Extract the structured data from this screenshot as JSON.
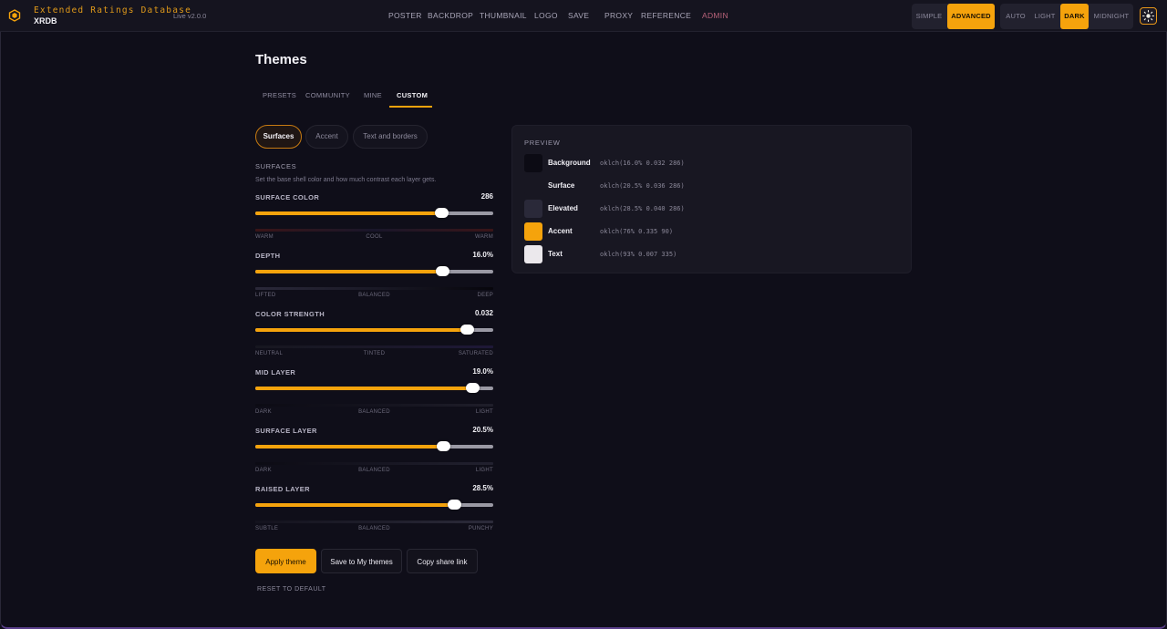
{
  "app": {
    "brand_title": "Extended Ratings Database",
    "brand_sub": "XRDB",
    "version": "Live v2.0.0",
    "logo_icon": "hexagon-cube-icon"
  },
  "nav": [
    "POSTER",
    "BACKDROP",
    "THUMBNAIL",
    "LOGO",
    "SAVE",
    "PROXY",
    "REFERENCE",
    "ADMIN"
  ],
  "mode_toggle": {
    "options": [
      "SIMPLE",
      "ADVANCED"
    ],
    "selected": "ADVANCED"
  },
  "theme_toggle": {
    "options": [
      "AUTO",
      "LIGHT",
      "DARK",
      "MIDNIGHT"
    ],
    "selected": "DARK"
  },
  "settings_icon": "sun-icon",
  "page": {
    "title": "Themes",
    "tabs": [
      "PRESETS",
      "COMMUNITY",
      "MINE",
      "CUSTOM"
    ],
    "active_tab": "CUSTOM"
  },
  "subtabs": [
    "Surfaces",
    "Accent",
    "Text and borders"
  ],
  "section": {
    "title": "SURFACES",
    "description": "Set the base shell color and how much contrast each layer gets."
  },
  "sliders": [
    {
      "label": "SURFACE COLOR",
      "value": "286",
      "fraction": 0.78,
      "marks": [
        "WARM",
        "COOL",
        "WARM"
      ]
    },
    {
      "label": "DEPTH",
      "value": "16.0%",
      "fraction": 0.785,
      "marks": [
        "LIFTED",
        "BALANCED",
        "DEEP"
      ]
    },
    {
      "label": "COLOR STRENGTH",
      "value": "0.032",
      "fraction": 0.89,
      "marks": [
        "NEUTRAL",
        "TINTED",
        "SATURATED"
      ]
    },
    {
      "label": "MID LAYER",
      "value": "19.0%",
      "fraction": 0.91,
      "marks": [
        "DARK",
        "BALANCED",
        "LIGHT"
      ]
    },
    {
      "label": "SURFACE LAYER",
      "value": "20.5%",
      "fraction": 0.79,
      "marks": [
        "DARK",
        "BALANCED",
        "LIGHT"
      ]
    },
    {
      "label": "RAISED LAYER",
      "value": "28.5%",
      "fraction": 0.835,
      "marks": [
        "SUBTLE",
        "BALANCED",
        "PUNCHY"
      ]
    }
  ],
  "actions": {
    "apply": "Apply theme",
    "save": "Save to My themes",
    "share": "Copy share link",
    "reset": "RESET TO DEFAULT"
  },
  "preview": {
    "title": "PREVIEW",
    "rows": [
      {
        "name": "Background",
        "value": "oklch(16.0% 0.032 286)",
        "color": "#0c0b14"
      },
      {
        "name": "Surface",
        "value": "oklch(20.5% 0.036 286)",
        "color": "#181722"
      },
      {
        "name": "Elevated",
        "value": "oklch(28.5% 0.040 286)",
        "color": "#2a2939"
      },
      {
        "name": "Accent",
        "value": "oklch(76% 0.335 90)",
        "color": "#f5a30c"
      },
      {
        "name": "Text",
        "value": "oklch(93% 0.007 335)",
        "color": "#ebe8ec"
      }
    ]
  },
  "colors": {
    "accent": "#f5a30c",
    "background": "#0f0e19",
    "admin": "#b8637a"
  }
}
